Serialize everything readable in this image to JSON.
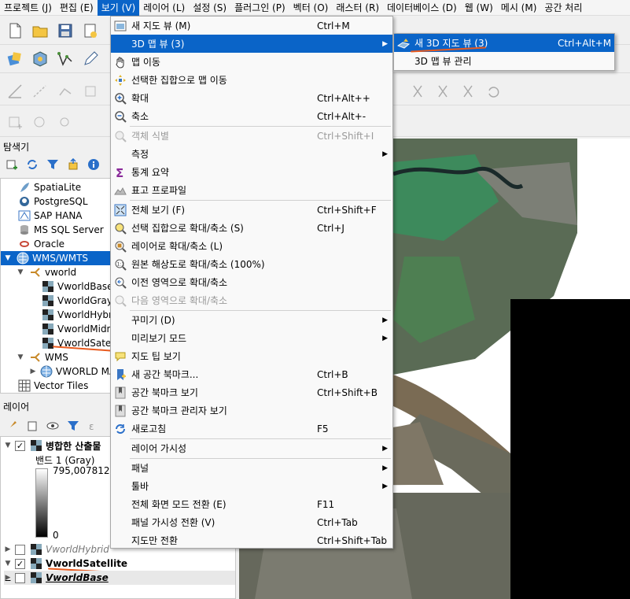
{
  "menubar": {
    "items": [
      "프로젝트 (J)",
      "편집 (E)",
      "보기 (V)",
      "레이어 (L)",
      "설정 (S)",
      "플러그인 (P)",
      "벡터 (O)",
      "래스터 (R)",
      "데이터베이스 (D)",
      "웹 (W)",
      "메시 (M)",
      "공간 처리"
    ]
  },
  "browser": {
    "title": "탐색기",
    "items": [
      {
        "label": "SpatiaLite",
        "icon": "feather-icon"
      },
      {
        "label": "PostgreSQL",
        "icon": "elephant-icon"
      },
      {
        "label": "SAP HANA",
        "icon": "hana-icon"
      },
      {
        "label": "MS SQL Server",
        "icon": "database-icon"
      },
      {
        "label": "Oracle",
        "icon": "oracle-icon"
      },
      {
        "label": "WMS/WMTS",
        "icon": "globe-icon"
      },
      {
        "label": "vworld",
        "icon": "connection-icon"
      },
      {
        "label": "VworldBase",
        "icon": "raster-icon"
      },
      {
        "label": "VworldGray",
        "icon": "raster-icon"
      },
      {
        "label": "VworldHybri",
        "icon": "raster-icon"
      },
      {
        "label": "VworldMidn",
        "icon": "raster-icon"
      },
      {
        "label": "VworldSatell",
        "icon": "raster-icon"
      },
      {
        "label": "WMS",
        "icon": "connection-icon"
      },
      {
        "label": "VWORLD MA",
        "icon": "globe-icon"
      },
      {
        "label": "Vector Tiles",
        "icon": "grid-icon"
      }
    ]
  },
  "layers": {
    "title": "레이어",
    "merged_layer": "병합한 산출물",
    "band_label": "밴드 1 (Gray)",
    "max_value": "795,007812",
    "min_value": "0",
    "items": [
      {
        "label": "VworldHybrid",
        "checked": false
      },
      {
        "label": "VworldSatellite",
        "checked": true
      },
      {
        "label": "VworldBase",
        "checked": false
      }
    ]
  },
  "view_menu": {
    "items": [
      {
        "label": "새 지도 뷰 (M)",
        "shortcut": "Ctrl+M",
        "icon": "new-map-view-icon"
      },
      {
        "label": "3D 맵 뷰 (3)",
        "shortcut": "",
        "submenu": true,
        "highlight": true
      },
      {
        "label": "맵 이동",
        "icon": "pan-hand-icon"
      },
      {
        "label": "선택한 집합으로 맵 이동",
        "icon": "pan-to-selection-icon"
      },
      {
        "label": "확대",
        "shortcut": "Ctrl+Alt++",
        "icon": "zoom-in-icon"
      },
      {
        "label": "축소",
        "shortcut": "Ctrl+Alt+-",
        "icon": "zoom-out-icon"
      },
      {
        "label": "객체 식별",
        "shortcut": "Ctrl+Shift+I",
        "disabled": true,
        "icon": "identify-icon"
      },
      {
        "label": "측정",
        "submenu": true
      },
      {
        "label": "통계 요약",
        "icon": "sigma-icon"
      },
      {
        "label": "표고 프로파일",
        "icon": "elevation-profile-icon"
      },
      {
        "label": "전체 보기 (F)",
        "shortcut": "Ctrl+Shift+F",
        "icon": "zoom-full-icon"
      },
      {
        "label": "선택 집합으로 확대/축소 (S)",
        "shortcut": "Ctrl+J",
        "icon": "zoom-selection-icon"
      },
      {
        "label": "레이어로 확대/축소 (L)",
        "icon": "zoom-layer-icon"
      },
      {
        "label": "원본 해상도로 확대/축소 (100%)",
        "icon": "zoom-actual-icon"
      },
      {
        "label": "이전 영역으로 확대/축소",
        "icon": "zoom-last-icon"
      },
      {
        "label": "다음 영역으로 확대/축소",
        "disabled": true,
        "icon": "zoom-next-icon"
      },
      {
        "label": "꾸미기 (D)",
        "submenu": true
      },
      {
        "label": "미리보기 모드",
        "submenu": true
      },
      {
        "label": "지도 팁 보기",
        "icon": "map-tips-icon"
      },
      {
        "label": "새 공간 북마크...",
        "shortcut": "Ctrl+B",
        "icon": "new-bookmark-icon"
      },
      {
        "label": "공간 북마크 보기",
        "shortcut": "Ctrl+Shift+B",
        "icon": "show-bookmarks-icon"
      },
      {
        "label": "공간 북마크 관리자 보기",
        "icon": "bookmark-manager-icon"
      },
      {
        "label": "새로고침",
        "shortcut": "F5",
        "icon": "refresh-icon"
      },
      {
        "label": "레이어 가시성",
        "submenu": true
      },
      {
        "label": "패널",
        "submenu": true
      },
      {
        "label": "툴바",
        "submenu": true
      },
      {
        "label": "전체 화면 모드 전환 (E)",
        "shortcut": "F11"
      },
      {
        "label": "패널 가시성 전환 (V)",
        "shortcut": "Ctrl+Tab"
      },
      {
        "label": "지도만 전환",
        "shortcut": "Ctrl+Shift+Tab"
      }
    ]
  },
  "submenu_3d": {
    "items": [
      {
        "label": "새 3D 지도 뷰 (3)",
        "shortcut": "Ctrl+Alt+M",
        "highlight": true,
        "icon": "new-3d-map-icon"
      },
      {
        "label": "3D 맵 뷰 관리"
      }
    ]
  },
  "colors": {
    "accent": "#0a64c8",
    "annotation": "#e85a1e"
  }
}
